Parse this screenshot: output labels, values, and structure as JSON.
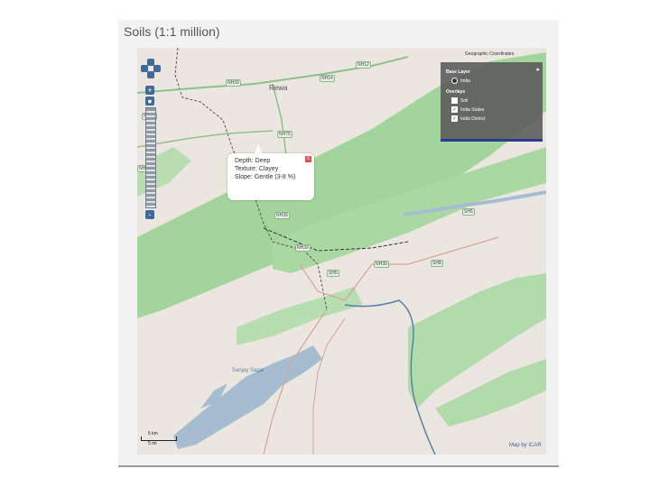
{
  "title": "Soils (1:1 million)",
  "coordinates_label": "Geographic Coordinates",
  "layers": {
    "base_heading": "Base Layer",
    "base_option": "India",
    "overlay_heading": "Overlays",
    "overlays": [
      {
        "label": "Soil",
        "checked": false
      },
      {
        "label": "India States",
        "checked": true
      },
      {
        "label": "India District",
        "checked": true
      }
    ]
  },
  "popup": {
    "line1": "Depth: Deep",
    "line2": "Texture: Clayey",
    "line3": "Slope: Gentle (3-8 %)",
    "close": "x"
  },
  "zoom": {
    "plus": "+",
    "minus": "-"
  },
  "scale": {
    "top": "5 km",
    "bottom": "5 mi"
  },
  "attribution": "Map by ICAR",
  "places": {
    "rewa": "Rewa",
    "sanjay": "Sanjay Sagar"
  },
  "roads": [
    "NH12",
    "NH39",
    "NH14",
    "NH12",
    "NH75",
    "NH39",
    "NH39",
    "SH5",
    "NH39",
    "SH5",
    "NH39",
    "SH8"
  ],
  "colors": {
    "accent": "#2c3b8e",
    "forest": "#9fd49a",
    "water": "#a6bdd1"
  }
}
